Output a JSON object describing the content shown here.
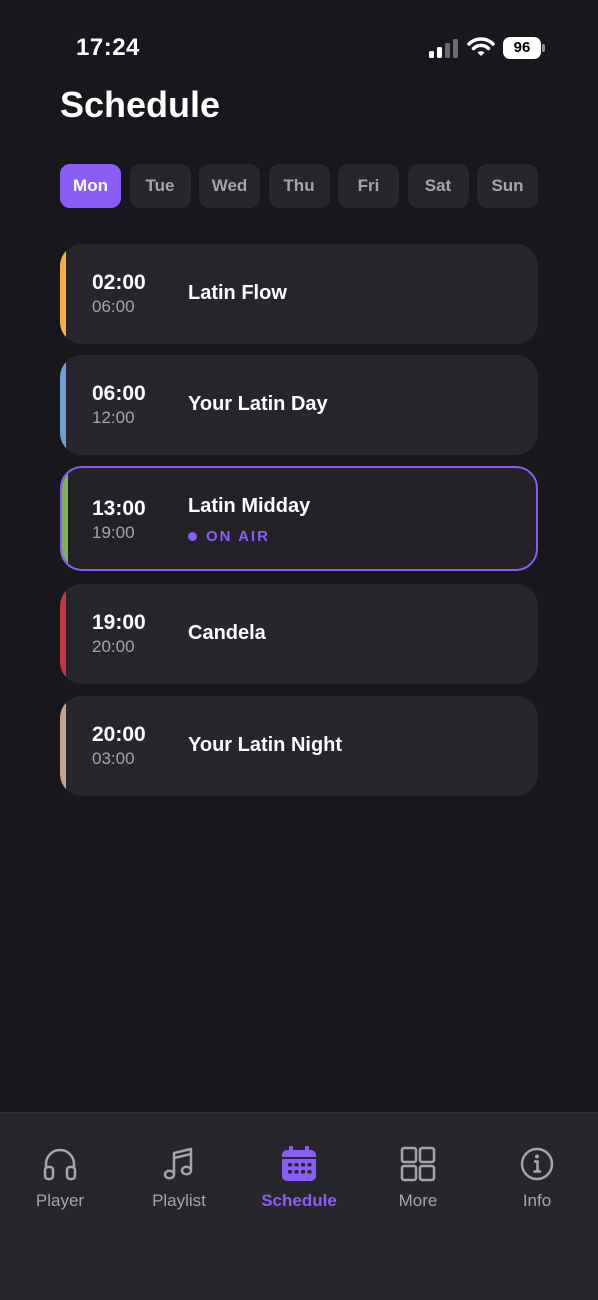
{
  "status_bar": {
    "time": "17:24",
    "battery": "96"
  },
  "header": {
    "title": "Schedule"
  },
  "days": [
    {
      "label": "Mon",
      "active": true
    },
    {
      "label": "Tue",
      "active": false
    },
    {
      "label": "Wed",
      "active": false
    },
    {
      "label": "Thu",
      "active": false
    },
    {
      "label": "Fri",
      "active": false
    },
    {
      "label": "Sat",
      "active": false
    },
    {
      "label": "Sun",
      "active": false
    }
  ],
  "shows": [
    {
      "start": "02:00",
      "end": "06:00",
      "name": "Latin Flow",
      "accent": "#f2b33d",
      "on_air": false
    },
    {
      "start": "06:00",
      "end": "12:00",
      "name": "Your Latin Day",
      "accent": "#6f9fd0",
      "on_air": false
    },
    {
      "start": "13:00",
      "end": "19:00",
      "name": "Latin Midday",
      "accent": "#7fb35a",
      "on_air": true,
      "on_air_label": "ON AIR"
    },
    {
      "start": "19:00",
      "end": "20:00",
      "name": "Candela",
      "accent": "#c8353d",
      "on_air": false
    },
    {
      "start": "20:00",
      "end": "03:00",
      "name": "Your Latin Night",
      "accent": "#c9a28a",
      "on_air": false
    }
  ],
  "tab_bar": {
    "items": [
      {
        "label": "Player",
        "icon": "headphones-icon",
        "active": false
      },
      {
        "label": "Playlist",
        "icon": "music-note-icon",
        "active": false
      },
      {
        "label": "Schedule",
        "icon": "calendar-icon",
        "active": true
      },
      {
        "label": "More",
        "icon": "grid-icon",
        "active": false
      },
      {
        "label": "Info",
        "icon": "info-icon",
        "active": false
      }
    ]
  },
  "colors": {
    "accent": "#8b5cf6",
    "background": "#18171c",
    "card": "#26262c",
    "muted_text": "#a5a4ab"
  }
}
